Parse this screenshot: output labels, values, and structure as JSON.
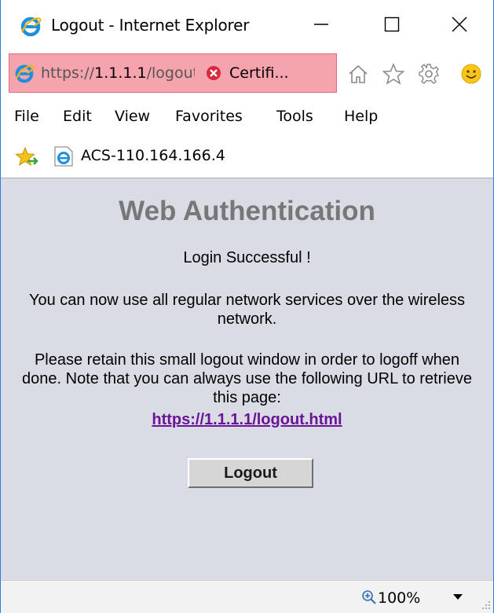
{
  "window": {
    "title": "Logout - Internet Explorer"
  },
  "address_bar": {
    "url_prefix": "https://",
    "url_host": "1.1.1.1",
    "url_path": "/logout",
    "cert_label": "Certifi..."
  },
  "toolbar_icons": [
    "home-icon",
    "favorites-star-icon",
    "settings-gear-icon",
    "smiley-feedback-icon"
  ],
  "menu": {
    "items": [
      "File",
      "Edit",
      "View",
      "Favorites",
      "Tools",
      "Help"
    ]
  },
  "favorites_bar": {
    "item_label": "ACS-110.164.166.4"
  },
  "page": {
    "title": "Web Authentication",
    "login_message": "Login Successful !",
    "info_message": "You can now use all regular network services over the wireless network.",
    "retain_message": "Please retain this small logout window in order to logoff when done. Note that you can always use the following URL to retrieve this page:",
    "logout_link": "https://1.1.1.1/logout.html",
    "logout_button": "Logout"
  },
  "status_bar": {
    "zoom": "100%"
  },
  "colors": {
    "window_border": "#2b7de0",
    "address_error_bg": "#f5a3ad",
    "content_bg": "#d9dce4",
    "title_gray": "#777777",
    "link": "#6b1596"
  }
}
